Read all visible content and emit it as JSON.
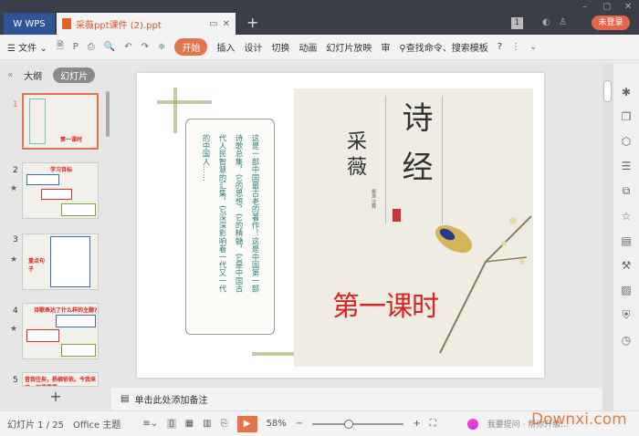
{
  "titlebar": {
    "app_tab": "WPS",
    "doc_tab": "采薇ppt课件 (2).ppt",
    "badge": "1",
    "login": "未登录",
    "new_tab": "+"
  },
  "toolbar": {
    "menu": "文件",
    "tabs": [
      "开始",
      "插入",
      "设计",
      "切换",
      "动画",
      "幻灯片放映",
      "审"
    ],
    "search": "查找命令、搜索模板",
    "help": "?"
  },
  "left_panel": {
    "tab_outline": "大纲",
    "tab_slides": "幻灯片",
    "slides": [
      {
        "num": "1",
        "title": "第一课时"
      },
      {
        "num": "2",
        "title": "学习目标"
      },
      {
        "num": "3",
        "title": "重点句子"
      },
      {
        "num": "4",
        "title": "诗歌表达了什么样的主题?"
      },
      {
        "num": "5",
        "title": "昔我往矣，杨柳依依。今我来思，雨雪霏霏。"
      }
    ],
    "add": "+"
  },
  "slide": {
    "scroll_columns": [
      "这是一部中国最古老的著作！这是中国第一部",
      "诗歌总集，它的思想，它的精髓，它是中国古",
      "代人民智慧的汇集，它深深影响着一代又一代",
      "的中国人……"
    ],
    "title_main": "诗经",
    "title_sub": "采薇",
    "lesson": "第一课时",
    "small_credit": "戴逸 注释"
  },
  "notes": {
    "placeholder": "单击此处添加备注"
  },
  "status": {
    "slide_count": "幻灯片 1 / 25",
    "theme": "Office 主题",
    "zoom": "58%",
    "zoom_fraction": 0.4,
    "watermark": "Downxi.com",
    "assist": "我要提问 · 帮你升级..."
  }
}
